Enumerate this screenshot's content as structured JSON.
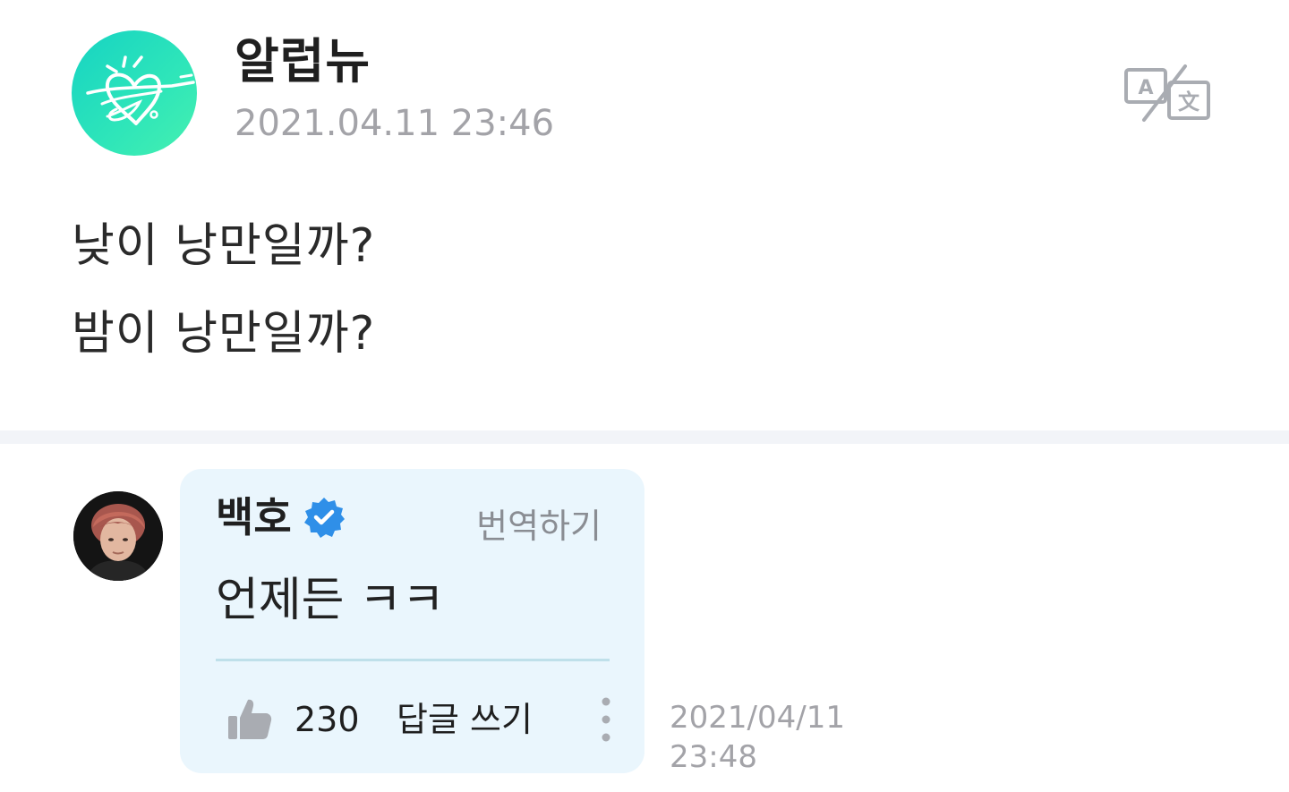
{
  "post": {
    "author_name": "알럽뉴",
    "date": "2021.04.11 23:46",
    "avatar_icon": "signature-heart-logo-icon",
    "translate_icon": "translate-icon",
    "lines": [
      "낮이 낭만일까?",
      "밤이 낭만일까?"
    ]
  },
  "comment": {
    "name": "백호",
    "verified_icon": "verified-badge-icon",
    "translate_label": "번역하기",
    "text": "언제든 ㅋㅋ",
    "like_icon": "thumbs-up-icon",
    "like_count": "230",
    "reply_label": "답글 쓰기",
    "more_icon": "more-vertical-icon",
    "date": "2021/04/11",
    "time": "23:48"
  },
  "colors": {
    "avatar_gradient_start": "#16d3c3",
    "avatar_gradient_end": "#46f0b0",
    "bubble_background": "#eaf6fd",
    "verified_blue": "#2f8fe8",
    "muted_text": "#a3a3a8",
    "divider_band": "#f2f4f8"
  }
}
